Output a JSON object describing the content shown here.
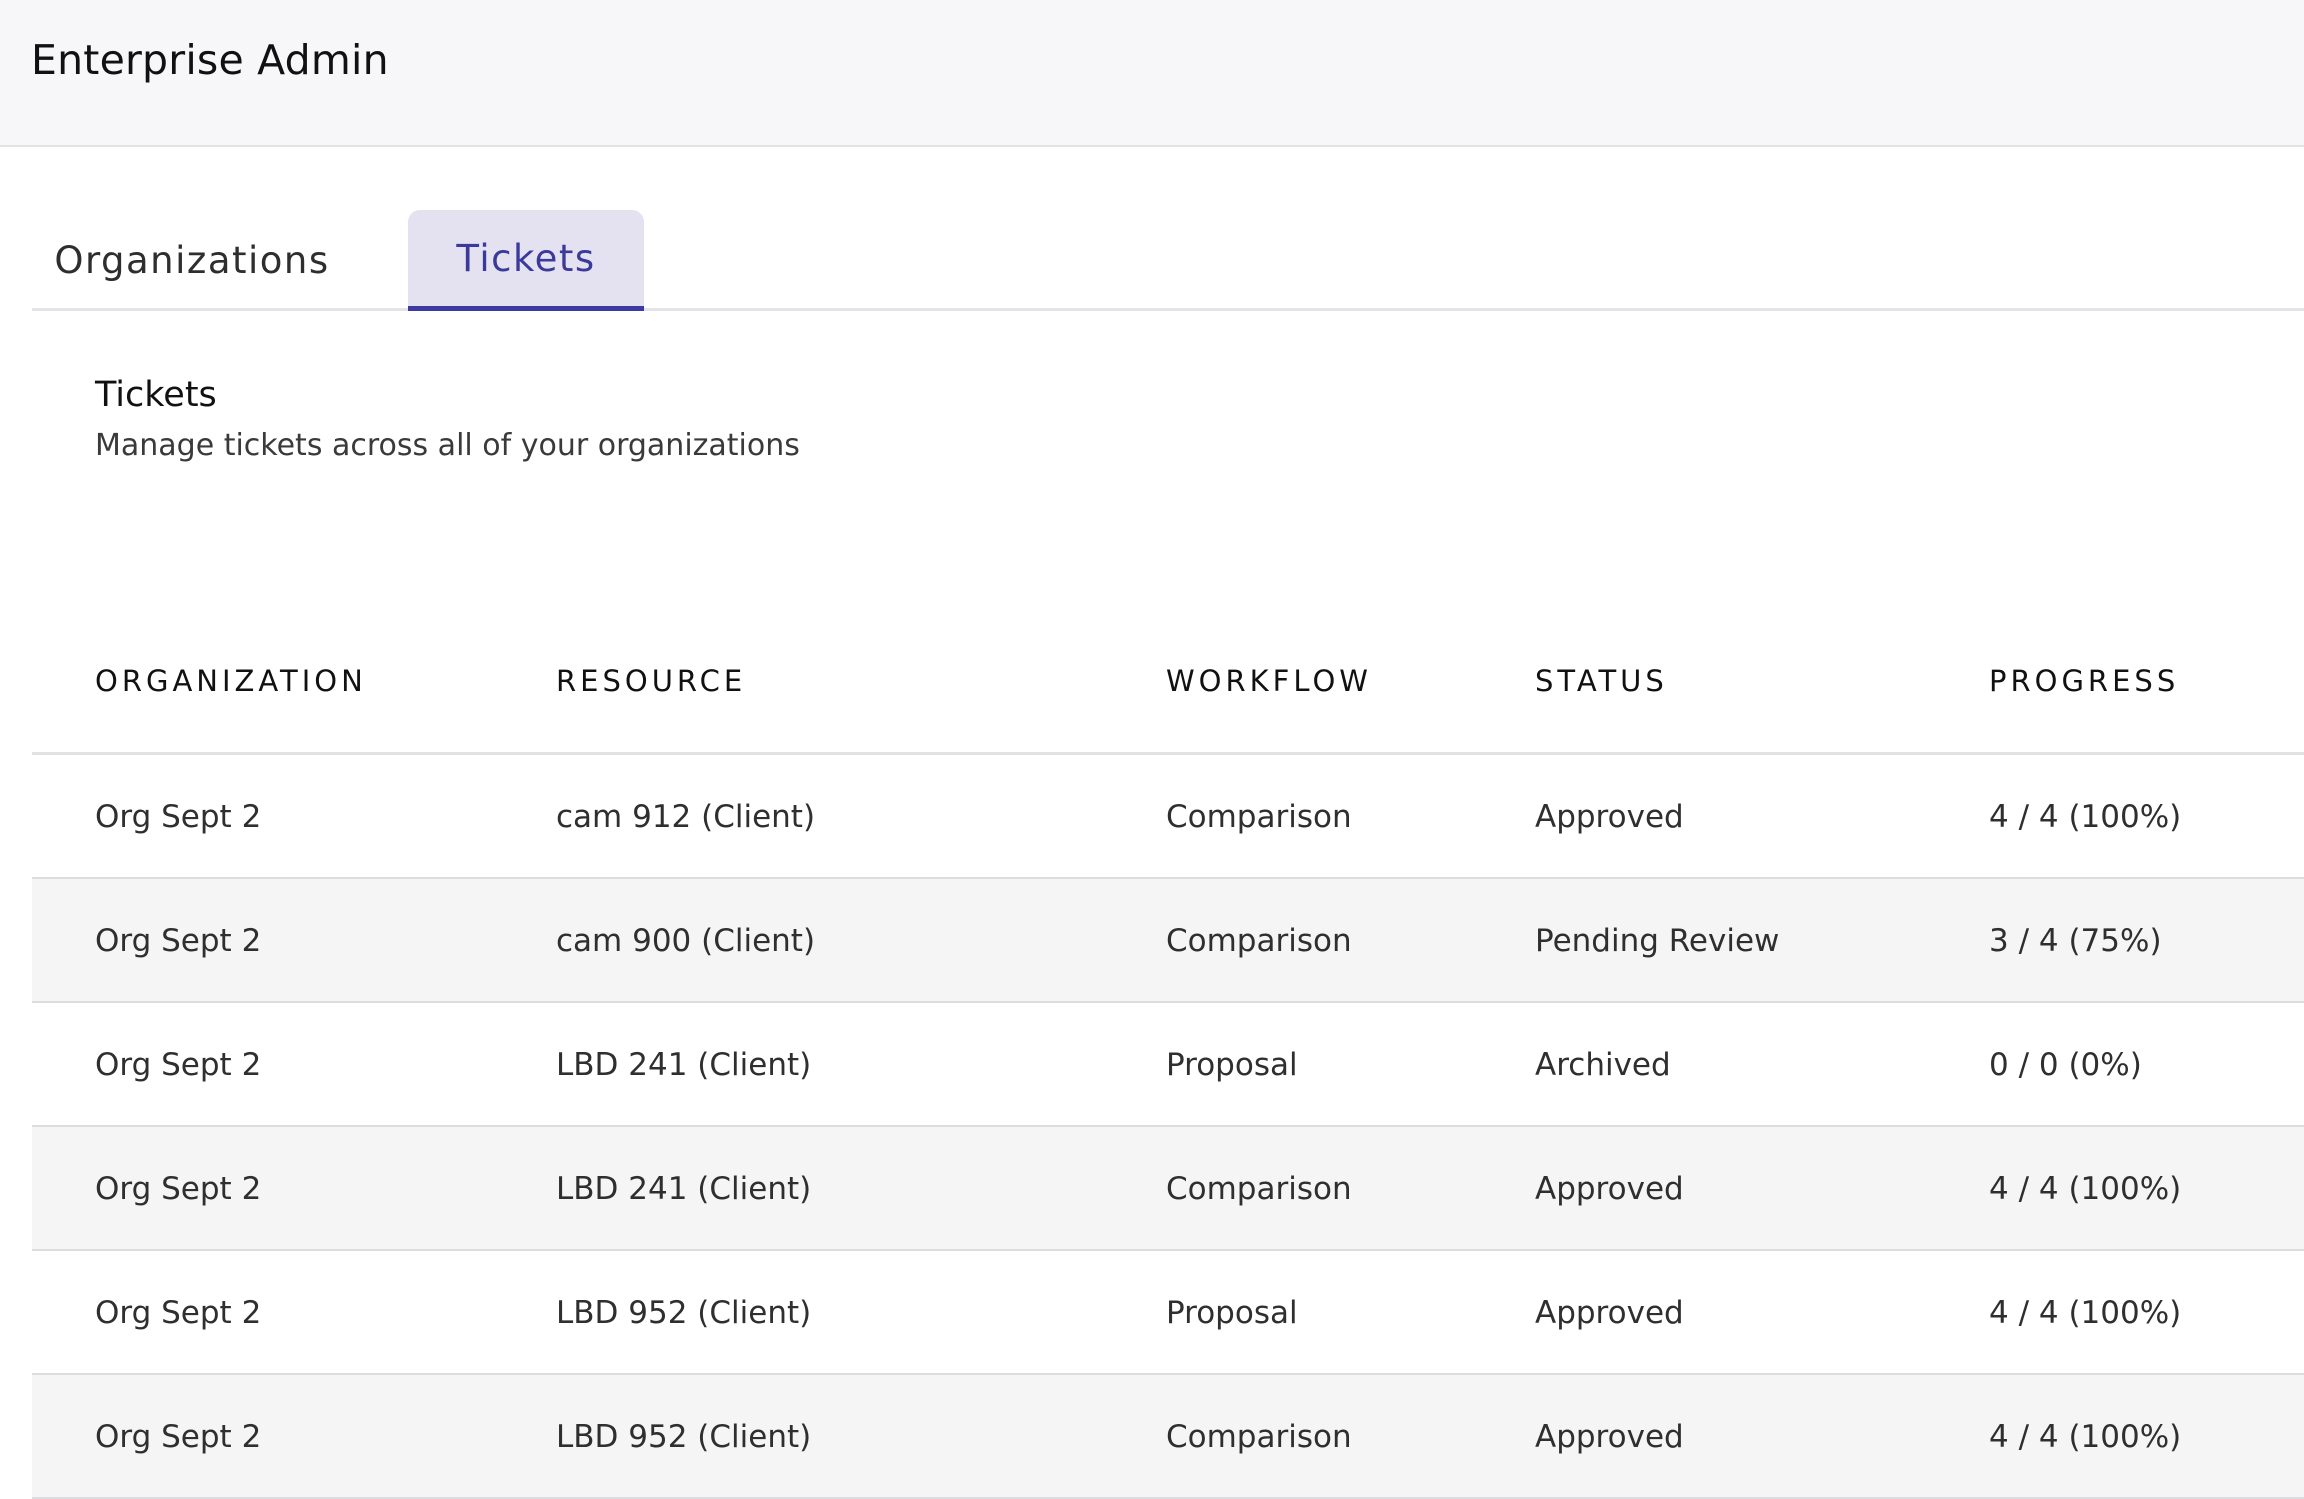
{
  "app": {
    "title": "Enterprise Admin"
  },
  "tabs": [
    {
      "label": "Organizations",
      "active": false
    },
    {
      "label": "Tickets",
      "active": true
    }
  ],
  "section": {
    "title": "Tickets",
    "subtitle": "Manage tickets across all of your organizations"
  },
  "colors": {
    "accent": "#3d3b9f",
    "active_tab_bg": "#e4e2f1",
    "stripe": "#f5f5f5"
  },
  "table": {
    "columns": [
      "ORGANIZATION",
      "RESOURCE",
      "WORKFLOW",
      "STATUS",
      "PROGRESS"
    ],
    "rows": [
      [
        "Org Sept 2",
        "cam 912 (Client)",
        "Comparison",
        "Approved",
        "4 / 4 (100%)"
      ],
      [
        "Org Sept 2",
        "cam 900 (Client)",
        "Comparison",
        "Pending Review",
        "3 / 4 (75%)"
      ],
      [
        "Org Sept 2",
        "LBD 241 (Client)",
        "Proposal",
        "Archived",
        "0 / 0 (0%)"
      ],
      [
        "Org Sept 2",
        "LBD 241 (Client)",
        "Comparison",
        "Approved",
        "4 / 4 (100%)"
      ],
      [
        "Org Sept 2",
        "LBD 952 (Client)",
        "Proposal",
        "Approved",
        "4 / 4 (100%)"
      ],
      [
        "Org Sept 2",
        "LBD 952 (Client)",
        "Comparison",
        "Approved",
        "4 / 4 (100%)"
      ]
    ]
  }
}
